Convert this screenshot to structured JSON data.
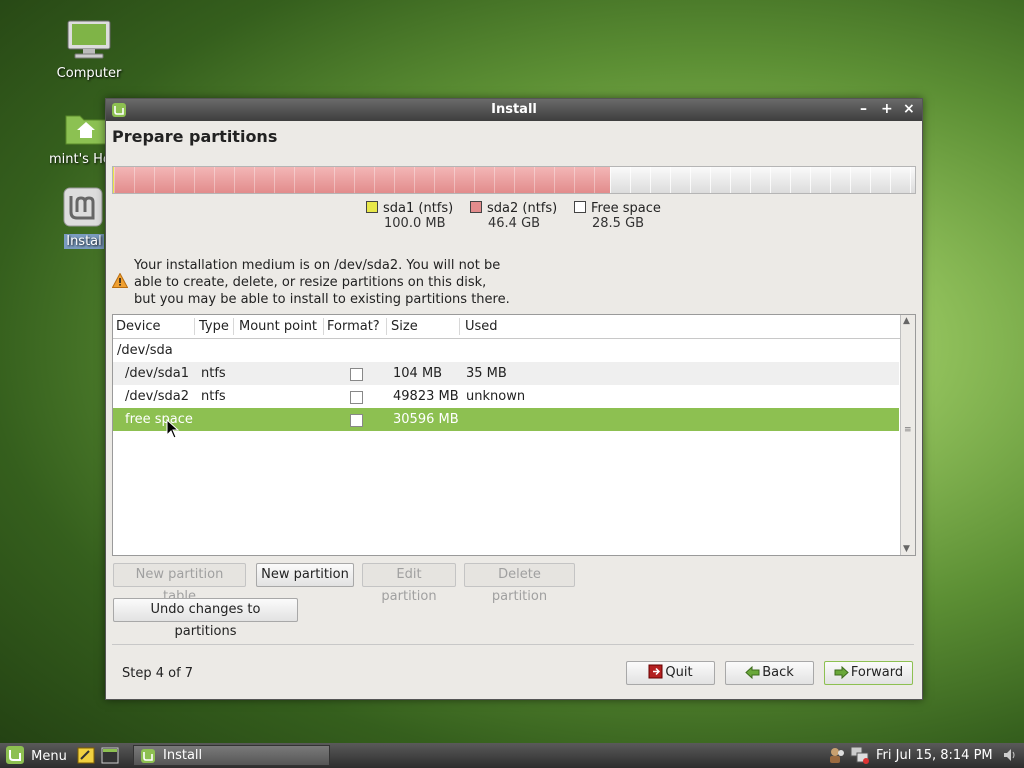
{
  "desktop": {
    "icons": [
      {
        "label": "Computer"
      },
      {
        "label": "mint's Ho"
      },
      {
        "label": "Instal"
      }
    ]
  },
  "window": {
    "title": "Install",
    "controls": {
      "minimize": "–",
      "maximize": "+",
      "close": "×"
    },
    "page_title": "Prepare partitions"
  },
  "disk_bar": {
    "segments": [
      {
        "name": "sda1 (ntfs)",
        "size": "100.0 MB",
        "fraction": 0.0012,
        "color": "#e8e84a"
      },
      {
        "name": "sda2 (ntfs)",
        "size": "46.4 GB",
        "fraction": 0.6188,
        "color": "#e28c8c"
      },
      {
        "name": "Free space",
        "size": "28.5 GB",
        "fraction": 0.38,
        "color": "#f5f5f5"
      }
    ]
  },
  "legend": [
    {
      "name": "sda1 (ntfs)",
      "size": "100.0 MB",
      "color": "#e8e84a"
    },
    {
      "name": "sda2 (ntfs)",
      "size": "46.4 GB",
      "color": "#e28c8c"
    },
    {
      "name": "Free space",
      "size": "28.5 GB",
      "color": "#ffffff"
    }
  ],
  "warning": {
    "lines": [
      "Your installation medium is on /dev/sda2. You will not be",
      "able to create, delete, or resize partitions on this disk,",
      "but you may be able to install to existing partitions there."
    ]
  },
  "table": {
    "headers": [
      "Device",
      "Type",
      "Mount point",
      "Format?",
      "Size",
      "Used"
    ],
    "group": "/dev/sda",
    "rows": [
      {
        "device": "/dev/sda1",
        "type": "ntfs",
        "mount": "",
        "format": false,
        "size": "104 MB",
        "used": "35 MB"
      },
      {
        "device": "/dev/sda2",
        "type": "ntfs",
        "mount": "",
        "format": false,
        "size": "49823 MB",
        "used": "unknown"
      },
      {
        "device": "free space",
        "type": "",
        "mount": "",
        "format": false,
        "size": "30596 MB",
        "used": "",
        "selected": true
      }
    ]
  },
  "buttons": {
    "new_partition_table": "New partition table",
    "new_partition": "New partition",
    "edit_partition": "Edit partition",
    "delete_partition": "Delete partition",
    "undo_changes": "Undo changes to partitions",
    "quit": "Quit",
    "back": "Back",
    "forward": "Forward"
  },
  "footer": {
    "step": "Step 4 of 7"
  },
  "taskbar": {
    "menu_label": "Menu",
    "window_label": "Install",
    "clock": "Fri Jul 15,  8:14 PM"
  }
}
